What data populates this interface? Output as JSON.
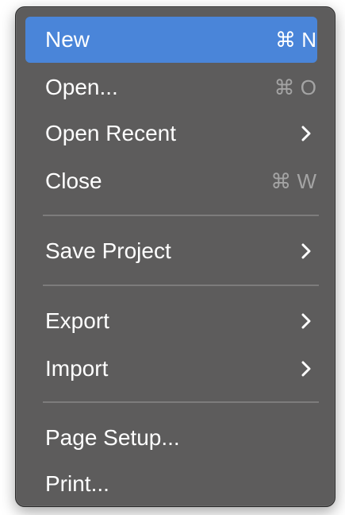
{
  "menu": {
    "items": [
      {
        "label": "New",
        "shortcut": "⌘ N"
      },
      {
        "label": "Open...",
        "shortcut": "⌘ O"
      },
      {
        "label": "Open Recent",
        "icon": "chevron-right-icon"
      },
      {
        "label": "Close",
        "shortcut": "⌘ W"
      },
      {
        "label": "Save Project",
        "icon": "chevron-right-icon"
      },
      {
        "label": "Export",
        "icon": "chevron-right-icon"
      },
      {
        "label": "Import",
        "icon": "chevron-right-icon"
      },
      {
        "label": "Page Setup..."
      },
      {
        "label": "Print..."
      }
    ],
    "highlighted": "New",
    "colors": {
      "background": "#5d5c5c",
      "highlight": "#4a85d9",
      "text": "#ffffff",
      "shortcut_dim": "#a4a4a4",
      "separator": "#7d7c7c"
    }
  }
}
